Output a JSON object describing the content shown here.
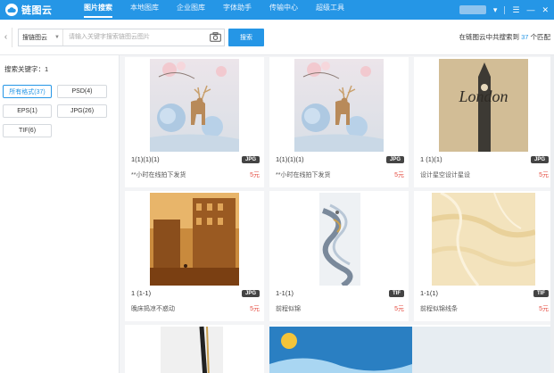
{
  "app": {
    "logo_text": "链图云"
  },
  "nav": [
    "图片搜索",
    "本地图库",
    "企业图库",
    "字体助手",
    "传输中心",
    "超级工具"
  ],
  "window_controls": {
    "menu": "☰",
    "minimize": "—",
    "close": "✕"
  },
  "search": {
    "scope": "搜链图云",
    "placeholder": "请输入关键字搜索链图云图片",
    "button": "搜索",
    "result_prefix": "在链图云中共搜索到",
    "result_count": "37",
    "result_suffix": "个匹配"
  },
  "sidebar": {
    "keyword_label": "搜索关键字：1",
    "formats": [
      {
        "label": "所有格式(37)",
        "active": true
      },
      {
        "label": "PSD(4)",
        "active": false
      },
      {
        "label": "EPS(1)",
        "active": false
      },
      {
        "label": "JPG(26)",
        "active": false
      },
      {
        "label": "TIF(6)",
        "active": false
      }
    ]
  },
  "results": [
    {
      "name": "1(1)(1)(1)",
      "type": "JPG",
      "desc": "**小时在线拍下发货",
      "price": "5元",
      "art": "deer"
    },
    {
      "name": "1(1)(1)(1)",
      "type": "JPG",
      "desc": "**小时在线拍下发货",
      "price": "5元",
      "art": "deer"
    },
    {
      "name": "1 (1)(1)",
      "type": "JPG",
      "desc": "设计星空设计星设",
      "price": "5元",
      "art": "london",
      "art_text": "London"
    },
    {
      "name": "1 (1-1)",
      "type": "JPG",
      "desc": "晚床捣凉不惑动",
      "price": "5元",
      "art": "street"
    },
    {
      "name": "1-1(1)",
      "type": "TIF",
      "desc": "前程似锦",
      "price": "5元",
      "art": "ink"
    },
    {
      "name": "1-1(1)",
      "type": "TIF",
      "desc": "前程似锦线条",
      "price": "5元",
      "art": "marble"
    }
  ],
  "colors": {
    "primary": "#2596e6",
    "price": "#e54d42",
    "tag": "#444444"
  }
}
